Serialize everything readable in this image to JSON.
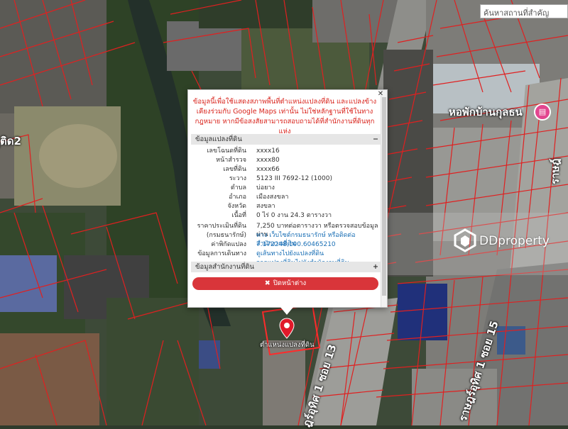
{
  "search": {
    "placeholder": "ค้นหาสถานที่สำคัญ"
  },
  "map": {
    "road_labels": [
      "ุติด2",
      "ราษฎ์",
      "ฎร์อุทิศ 1 ซอย 13",
      "ราษฎร์อุทิศ 1 ซอย 15"
    ],
    "poi": {
      "name": "หอพักบ้านกุลธน",
      "icon": "bed-icon",
      "color": "#e2458f"
    },
    "marker": {
      "label": "ตำแหน่งแปลงที่ดิน",
      "icon": "map-pin-icon",
      "color": "#e0192a"
    },
    "parcel_line_color": "#e02020"
  },
  "popup": {
    "notice": "ข้อมูลนี้เพื่อใช้แสดงสภาพพื้นที่ตำแหน่งแปลงที่ดิน และแปลงข้างเคียงร่วมกับ Google Maps เท่านั้น ไม่ใช่หลักฐานที่ใช้ในทางกฎหมาย หากมีข้อสงสัยสามารถสอบถามได้ที่สำนักงานที่ดินทุกแห่ง",
    "section_parcel": "ข้อมูลแปลงที่ดิน",
    "section_parcel_sign": "−",
    "rows": [
      {
        "k": "เลขโฉนดที่ดิน",
        "v": "xxxx16"
      },
      {
        "k": "หน้าสำรวจ",
        "v": "xxxx80"
      },
      {
        "k": "เลขที่ดิน",
        "v": "xxxx66"
      },
      {
        "k": "ระวาง",
        "v": "5123 III 7692-12 (1000)"
      },
      {
        "k": "ตำบล",
        "v": "บ่อยาง"
      },
      {
        "k": "อำเภอ",
        "v": "เมืองสงขลา"
      },
      {
        "k": "จังหวัด",
        "v": "สงขลา"
      },
      {
        "k": "เนื้อที่",
        "v": "0 ไร่ 0 งาน 24.3 ตารางวา"
      },
      {
        "k": "ราคาประเมินที่ดิน",
        "v": "7,250 บาทต่อตารางวา หรือตรวจสอบข้อมูลผ่าน"
      },
      {
        "k": "(กรมธนารักษ์)",
        "v": "ทาง เว็บไซต์กรมธนารักษ์ หรือติดต่อสำนักงานที่ดิน"
      },
      {
        "k": "ค่าพิกัดแปลง",
        "v": "7.172248,100.60465210"
      },
      {
        "k": "ข้อมูลการเดินทาง",
        "v": "ดูเส้นทางไปยังแปลงที่ดิน"
      },
      {
        "k": "",
        "v": "จากแปลงที่ดินไปยังสำนักงานที่ดิน"
      }
    ],
    "section_office": "ข้อมูลสำนักงานที่ดิน",
    "section_office_sign": "+",
    "close_button": "ปิดหน้าต่าง",
    "close_icon": "close-icon"
  },
  "watermark": {
    "text": "DDproperty",
    "icon": "ddproperty-logo-icon"
  }
}
